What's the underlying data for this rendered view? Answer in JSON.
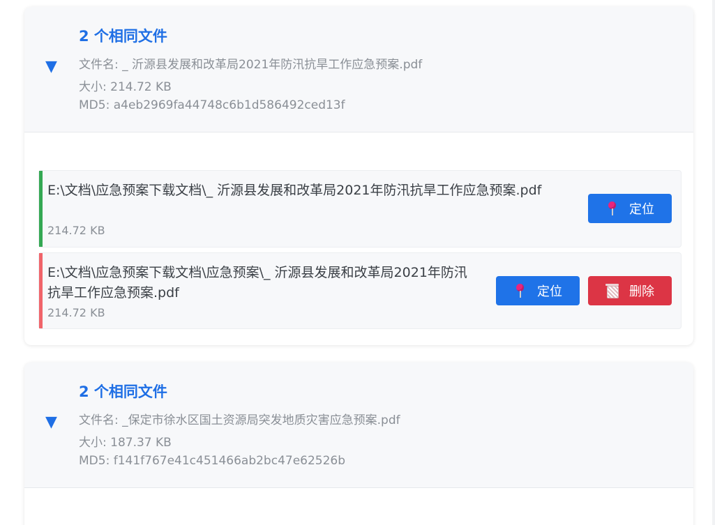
{
  "groups": [
    {
      "title": "2 个相同文件",
      "filename_line": "文件名: _ 沂源县发展和改革局2021年防汛抗旱工作应急预案.pdf",
      "size_line": "大小: 214.72 KB",
      "md5_line": "MD5: a4eb2969fa44748c6b1d586492ced13f",
      "files": [
        {
          "path": "E:\\文档\\应急预案下载文档\\_ 沂源县发展和改革局2021年防汛抗旱工作应急预案.pdf",
          "size": "214.72 KB",
          "status_color": "#34a853",
          "locate_label": "定位"
        },
        {
          "path": "E:\\文档\\应急预案下载文档\\应急预案\\_ 沂源县发展和改革局2021年防汛抗旱工作应急预案.pdf",
          "size": "214.72 KB",
          "status_color": "#f0646a",
          "locate_label": "定位",
          "delete_label": "删除"
        }
      ]
    },
    {
      "title": "2 个相同文件",
      "filename_line": "文件名: _保定市徐水区国土资源局突发地质灾害应急预案.pdf",
      "size_line": "大小: 187.37 KB",
      "md5_line": "MD5: f141f767e41c451466ab2bc47e62526b"
    }
  ],
  "icons": {
    "toggle": "triangle-down-icon",
    "locate": "pushpin-icon",
    "delete": "wastebasket-icon"
  },
  "colors": {
    "accent": "#1f6fe5",
    "locate_button": "#1f73e8",
    "delete_button": "#dc3545"
  }
}
